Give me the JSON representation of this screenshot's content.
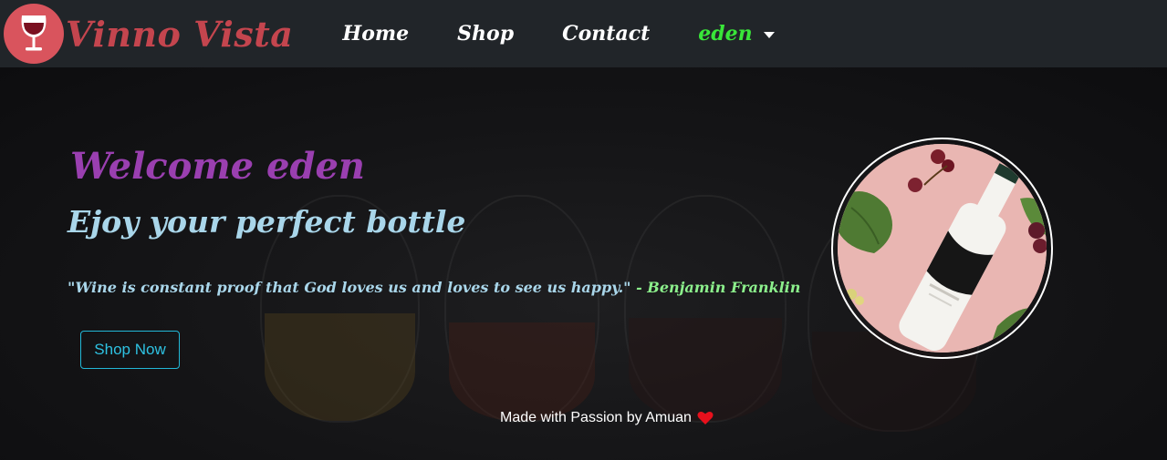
{
  "nav": {
    "brand": "Vinno Vista",
    "links": [
      "Home",
      "Shop",
      "Contact"
    ],
    "user": "eden"
  },
  "hero": {
    "welcome": "Welcome eden",
    "subtitle": "Ejoy your perfect bottle",
    "quote": "\"Wine is constant proof that God loves us and loves to see us happy.\"",
    "quote_author": " - Benjamin Franklin",
    "cta": "Shop Now",
    "footer_note": "Made with Passion by Amuan"
  },
  "colors": {
    "navbar": "#212529",
    "brand": "#c4454e",
    "user_link": "#39e639",
    "welcome": "#9a3fb0",
    "subtitle": "#a9d6ea",
    "author": "#8cf08c",
    "cta": "#22b7d6",
    "heart": "#e8101c"
  },
  "icons": {
    "logo": "wine-glass-icon",
    "dropdown": "caret-down-icon",
    "heart": "heart-icon"
  }
}
